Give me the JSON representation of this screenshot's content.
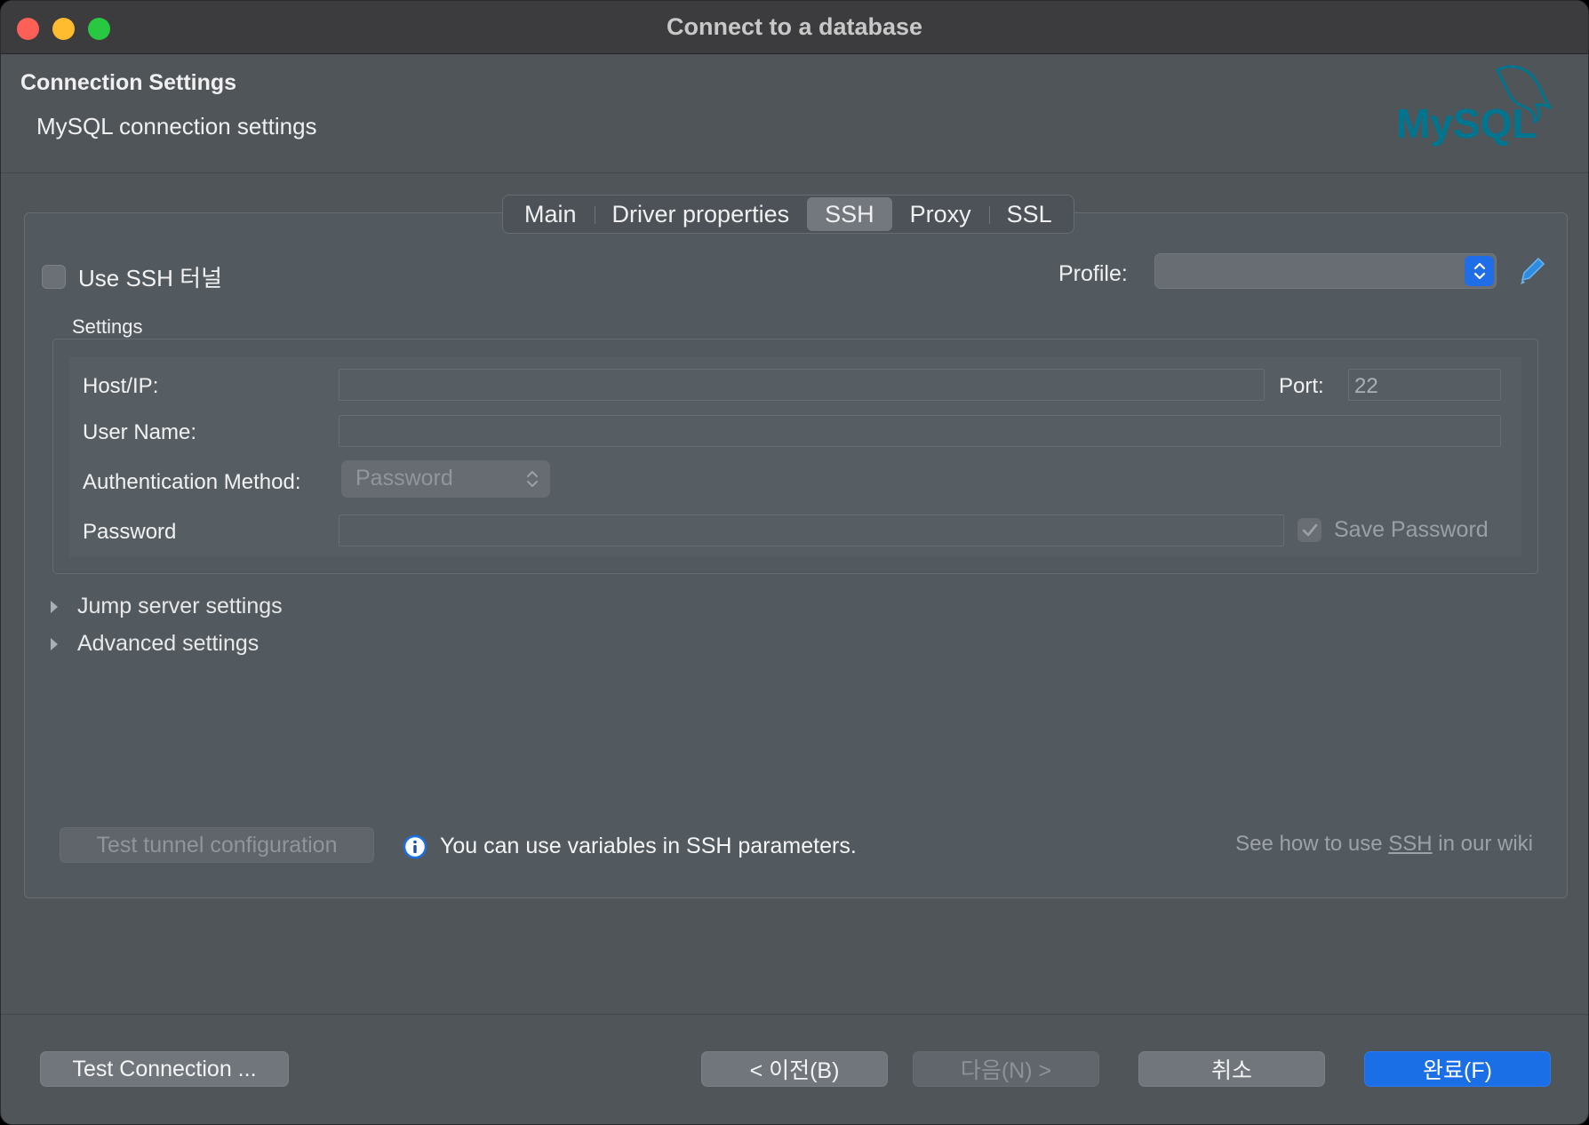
{
  "window": {
    "title": "Connect to a database"
  },
  "header": {
    "title": "Connection Settings",
    "subtitle": "MySQL connection settings",
    "logo_text": "MySQL"
  },
  "tabs": [
    {
      "label": "Main",
      "active": false
    },
    {
      "label": "Driver properties",
      "active": false
    },
    {
      "label": "SSH",
      "active": true
    },
    {
      "label": "Proxy",
      "active": false
    },
    {
      "label": "SSL",
      "active": false
    }
  ],
  "ssh": {
    "use_tunnel_label": "Use SSH 터널",
    "use_tunnel_checked": false,
    "profile_label": "Profile:",
    "profile_value": "",
    "settings_label": "Settings",
    "host_label": "Host/IP:",
    "host_value": "",
    "port_label": "Port:",
    "port_value": "22",
    "user_label": "User Name:",
    "user_value": "",
    "auth_label": "Authentication Method:",
    "auth_value": "Password",
    "password_label": "Password",
    "password_value": "",
    "save_password_label": "Save Password",
    "save_password_checked": true
  },
  "expanders": {
    "jump_server": "Jump server settings",
    "advanced": "Advanced settings"
  },
  "bottom": {
    "test_tunnel": "Test tunnel configuration",
    "info_text": "You can use variables in SSH parameters.",
    "wiki_prefix": "See how to use ",
    "wiki_link": "SSH",
    "wiki_suffix": " in our wiki"
  },
  "footer": {
    "test_connection": "Test Connection ...",
    "back": "< 이전(B)",
    "next": "다음(N) >",
    "cancel": "취소",
    "finish": "완료(F)"
  },
  "colors": {
    "accent": "#1b6fe6",
    "mysql_teal": "#00758f",
    "mysql_orange": "#f29111"
  }
}
